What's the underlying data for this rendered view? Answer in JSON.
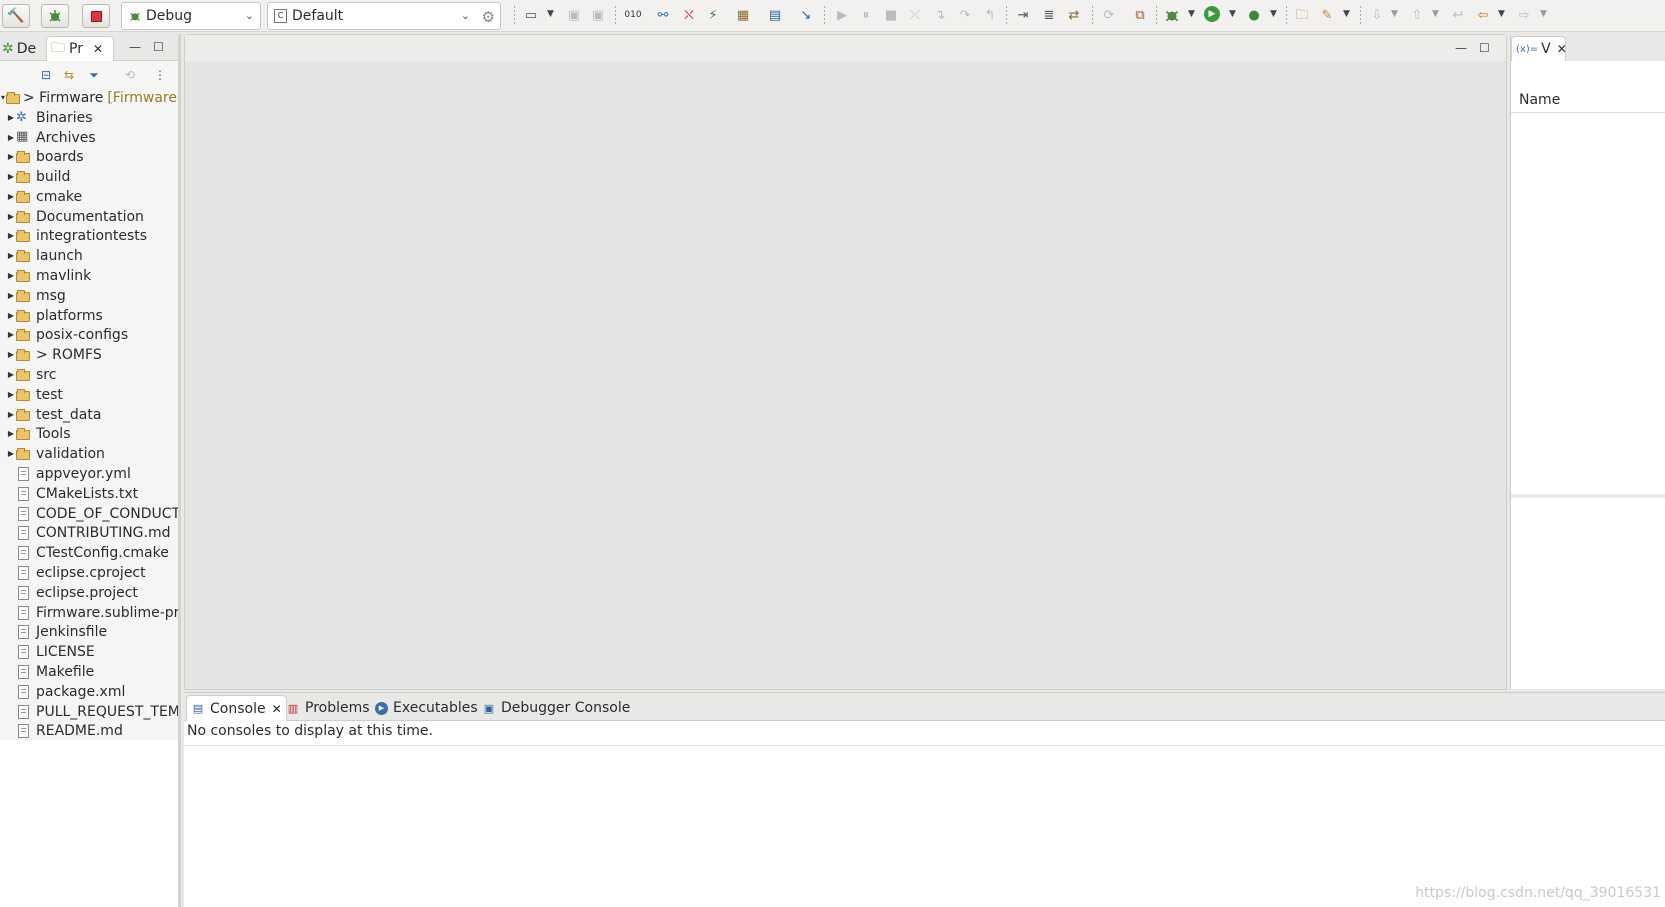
{
  "toolbar": {
    "launch_mode": "Debug",
    "launch_target": "Default",
    "icons": [
      "hammer-icon",
      "bug-icon",
      "stop-icon",
      "settings-gear-icon",
      "new-icon",
      "save-icon",
      "save-all-icon",
      "binary-icon",
      "connect-icon",
      "disconnect-icon",
      "plug-icon",
      "package-icon",
      "terminal-icon",
      "pointer-icon",
      "resume-icon",
      "suspend-icon",
      "terminate-icon",
      "disconnect-debug-icon",
      "step-into-icon",
      "step-over-icon",
      "step-return-icon",
      "instruction-step-icon",
      "instruction-mode-icon",
      "drop-to-frame-icon",
      "copy-tree-icon",
      "debug-icon",
      "run-icon",
      "external-tools-icon",
      "open-folder-icon",
      "search-icon",
      "next-annotation-icon",
      "prev-annotation-icon",
      "back-icon",
      "forward-icon"
    ]
  },
  "left_panel": {
    "tabs": [
      {
        "label": "De",
        "icon": "debug-view-icon"
      },
      {
        "label": "Pr",
        "icon": "project-explorer-icon"
      }
    ],
    "project": {
      "name": "> Firmware",
      "decoration": "[Firmware sg"
    },
    "tree": [
      {
        "label": "Binaries",
        "type": "binaries"
      },
      {
        "label": "Archives",
        "type": "archives"
      },
      {
        "label": "boards",
        "type": "folder"
      },
      {
        "label": "build",
        "type": "folder"
      },
      {
        "label": "cmake",
        "type": "folder"
      },
      {
        "label": "Documentation",
        "type": "folder"
      },
      {
        "label": "integrationtests",
        "type": "folder"
      },
      {
        "label": "launch",
        "type": "folder"
      },
      {
        "label": "mavlink",
        "type": "folder"
      },
      {
        "label": "msg",
        "type": "folder"
      },
      {
        "label": "platforms",
        "type": "folder"
      },
      {
        "label": "posix-configs",
        "type": "folder"
      },
      {
        "label": "> ROMFS",
        "type": "folder"
      },
      {
        "label": "src",
        "type": "folder"
      },
      {
        "label": "test",
        "type": "folder"
      },
      {
        "label": "test_data",
        "type": "folder"
      },
      {
        "label": "Tools",
        "type": "folder"
      },
      {
        "label": "validation",
        "type": "folder"
      },
      {
        "label": "appveyor.yml",
        "type": "file"
      },
      {
        "label": "CMakeLists.txt",
        "type": "file"
      },
      {
        "label": "CODE_OF_CONDUCT.m",
        "type": "file"
      },
      {
        "label": "CONTRIBUTING.md",
        "type": "file"
      },
      {
        "label": "CTestConfig.cmake",
        "type": "file"
      },
      {
        "label": "eclipse.cproject",
        "type": "file"
      },
      {
        "label": "eclipse.project",
        "type": "file"
      },
      {
        "label": "Firmware.sublime-proj",
        "type": "file"
      },
      {
        "label": "Jenkinsfile",
        "type": "file"
      },
      {
        "label": "LICENSE",
        "type": "file"
      },
      {
        "label": "Makefile",
        "type": "file"
      },
      {
        "label": "package.xml",
        "type": "file"
      },
      {
        "label": "PULL_REQUEST_TEMP",
        "type": "file"
      },
      {
        "label": "README.md",
        "type": "file"
      }
    ]
  },
  "right_panel": {
    "tab_label": "V",
    "column_header": "Name"
  },
  "console": {
    "tabs": [
      {
        "label": "Console",
        "icon": "console-icon"
      },
      {
        "label": "Problems",
        "icon": "problems-icon"
      },
      {
        "label": "Executables",
        "icon": "executables-icon"
      },
      {
        "label": "Debugger Console",
        "icon": "debugger-console-icon"
      }
    ],
    "message": "No consoles to display at this time.",
    "watermark": "https://blog.csdn.net/qq_39016531"
  }
}
